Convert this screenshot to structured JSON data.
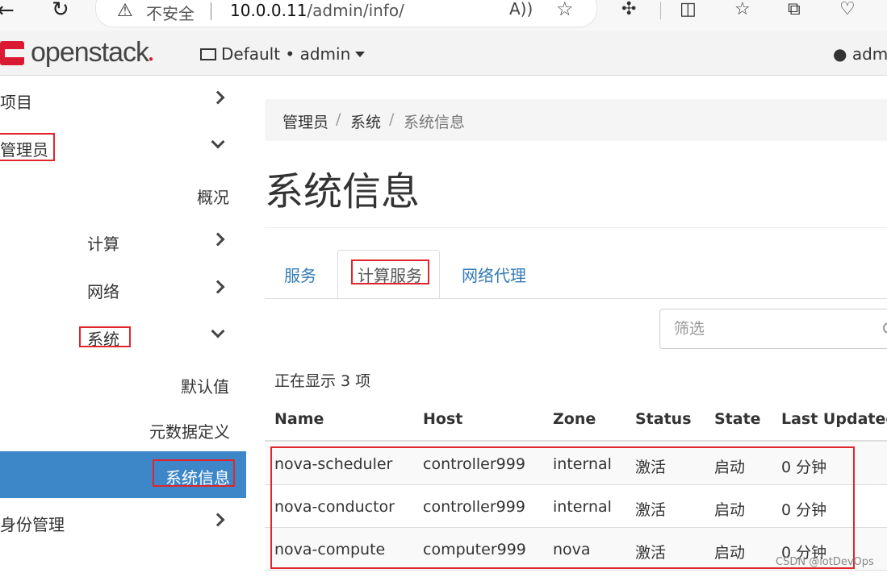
{
  "browser": {
    "security_label": "不安全",
    "url_host": "10.0.0.11",
    "url_path": "/admin/info/"
  },
  "header": {
    "logo_text": "openstack",
    "project_selector": "Default • admin",
    "user_menu": "admin"
  },
  "sidebar": {
    "items": [
      {
        "label": "项目"
      },
      {
        "label": "管理员"
      },
      {
        "label": "概况"
      },
      {
        "label": "计算"
      },
      {
        "label": "网络"
      },
      {
        "label": "系统"
      },
      {
        "label": "默认值"
      },
      {
        "label": "元数据定义"
      },
      {
        "label": "系统信息"
      },
      {
        "label": "身份管理"
      }
    ]
  },
  "breadcrumb": [
    "管理员",
    "系统",
    "系统信息"
  ],
  "breadcrumb_separator": "/",
  "page_title": "系统信息",
  "tabs": [
    {
      "label": "服务",
      "active": false
    },
    {
      "label": "计算服务",
      "active": true
    },
    {
      "label": "网络代理",
      "active": false
    }
  ],
  "filter": {
    "placeholder": "筛选"
  },
  "count_text": "正在显示 3 项",
  "table": {
    "columns": [
      "Name",
      "Host",
      "Zone",
      "Status",
      "State",
      "Last Updated"
    ],
    "rows": [
      [
        "nova-scheduler",
        "controller999",
        "internal",
        "激活",
        "启动",
        "0 分钟"
      ],
      [
        "nova-conductor",
        "controller999",
        "internal",
        "激活",
        "启动",
        "0 分钟"
      ],
      [
        "nova-compute",
        "computer999",
        "nova",
        "激活",
        "启动",
        "0 分钟"
      ]
    ]
  },
  "watermark": "CSDN @iotDevOps",
  "colors": {
    "brand_red": "#da1a32",
    "active_blue": "#3d87c8",
    "link_blue": "#337ab7",
    "annotation_red": "#e0262c"
  }
}
